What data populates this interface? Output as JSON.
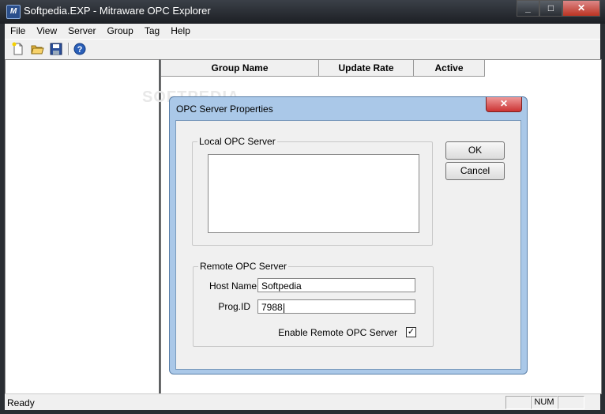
{
  "window": {
    "title": "Softpedia.EXP - Mitraware OPC Explorer",
    "minimize": "_",
    "maximize": "□",
    "close": "✕"
  },
  "menu": [
    "File",
    "View",
    "Server",
    "Group",
    "Tag",
    "Help"
  ],
  "toolbar": [
    "new-icon",
    "open-icon",
    "save-icon",
    "help-icon"
  ],
  "table": {
    "columns": [
      "Group Name",
      "Update Rate",
      "Active"
    ]
  },
  "watermark": "SOFTPEDIA",
  "status": {
    "text": "Ready",
    "num": "NUM"
  },
  "dialog": {
    "title": "OPC Server Properties",
    "close": "✕",
    "local_group": "Local OPC Server",
    "remote_group": "Remote OPC Server",
    "ok": "OK",
    "cancel": "Cancel",
    "host_label": "Host Name",
    "host_value": "Softpedia",
    "progid_label": "Prog.ID",
    "progid_value": "7988",
    "enable_label": "Enable Remote OPC Server",
    "enable_checked": true,
    "check_mark": "✓"
  }
}
